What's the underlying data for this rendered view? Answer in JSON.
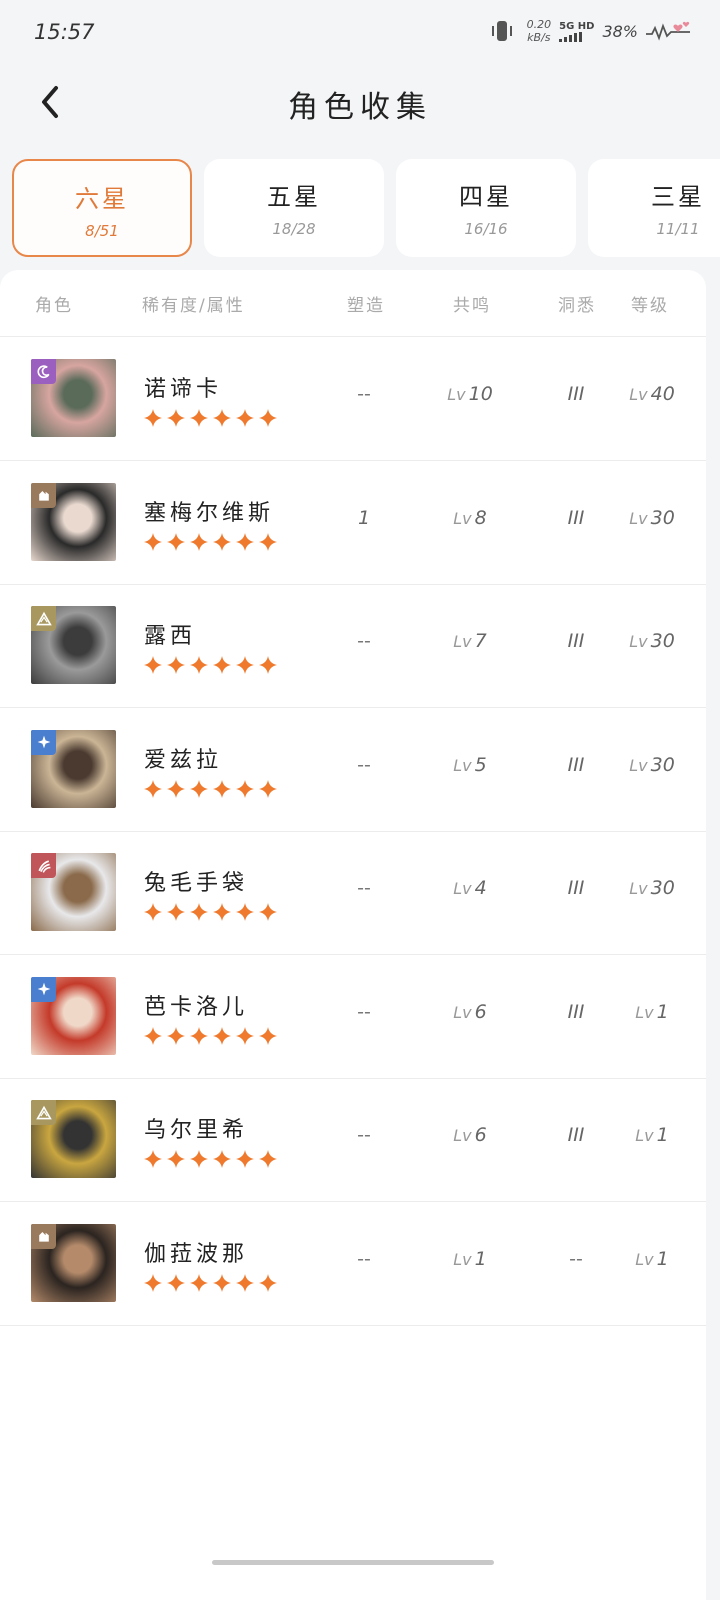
{
  "status": {
    "time": "15:57",
    "net_speed": "0.20",
    "net_unit": "kB/s",
    "signal": "5G HD",
    "battery": "38%"
  },
  "header": {
    "title": "角色收集"
  },
  "tabs": [
    {
      "name": "六星",
      "count": "8/51",
      "active": true
    },
    {
      "name": "五星",
      "count": "18/28",
      "active": false
    },
    {
      "name": "四星",
      "count": "16/16",
      "active": false
    },
    {
      "name": "三星",
      "count": "11/11",
      "active": false
    }
  ],
  "table": {
    "headers": [
      "角色",
      "稀有度/属性",
      "塑造",
      "共鸣",
      "洞悉",
      "等级"
    ],
    "lv_prefix": "Lv",
    "rows": [
      {
        "name": "诺谛卡",
        "stars": 6,
        "attr_icon": "moon-icon",
        "attr_color": "#9b5fc0",
        "shaping": "--",
        "resonance": "10",
        "insight": "III",
        "level": "40",
        "portrait": [
          "#d7a5a0",
          "#5a6b5a"
        ]
      },
      {
        "name": "塞梅尔维斯",
        "stars": 6,
        "attr_icon": "beast-icon",
        "attr_color": "#9a7a5c",
        "shaping": "1",
        "resonance": "8",
        "insight": "III",
        "level": "30",
        "portrait": [
          "#2a2a2a",
          "#e9d9cf"
        ]
      },
      {
        "name": "露西",
        "stars": 6,
        "attr_icon": "mineral-icon",
        "attr_color": "#a89860",
        "shaping": "--",
        "resonance": "7",
        "insight": "III",
        "level": "30",
        "portrait": [
          "#9a9a9a",
          "#3c3c3c"
        ]
      },
      {
        "name": "爱兹拉",
        "stars": 6,
        "attr_icon": "star-spark-icon",
        "attr_color": "#4a7ecf",
        "shaping": "--",
        "resonance": "5",
        "insight": "III",
        "level": "30",
        "portrait": [
          "#cbb596",
          "#4a3a30"
        ]
      },
      {
        "name": "兔毛手袋",
        "stars": 6,
        "attr_icon": "claw-icon",
        "attr_color": "#c0555a",
        "shaping": "--",
        "resonance": "4",
        "insight": "III",
        "level": "30",
        "portrait": [
          "#e8e8ea",
          "#8a6a4a"
        ]
      },
      {
        "name": "芭卡洛儿",
        "stars": 6,
        "attr_icon": "star-spark-icon",
        "attr_color": "#4a7ecf",
        "shaping": "--",
        "resonance": "6",
        "insight": "III",
        "level": "1",
        "portrait": [
          "#c43a2a",
          "#f0d8c8"
        ]
      },
      {
        "name": "乌尔里希",
        "stars": 6,
        "attr_icon": "mineral-icon",
        "attr_color": "#a89860",
        "shaping": "--",
        "resonance": "6",
        "insight": "III",
        "level": "1",
        "portrait": [
          "#c9a640",
          "#333333"
        ]
      },
      {
        "name": "伽菈波那",
        "stars": 6,
        "attr_icon": "beast-icon",
        "attr_color": "#9a7a5c",
        "shaping": "--",
        "resonance": "1",
        "insight": "--",
        "level": "1",
        "portrait": [
          "#2b2420",
          "#b48a6a"
        ]
      }
    ]
  },
  "colors": {
    "accent": "#e8874a",
    "star": "#ef7a2e"
  }
}
